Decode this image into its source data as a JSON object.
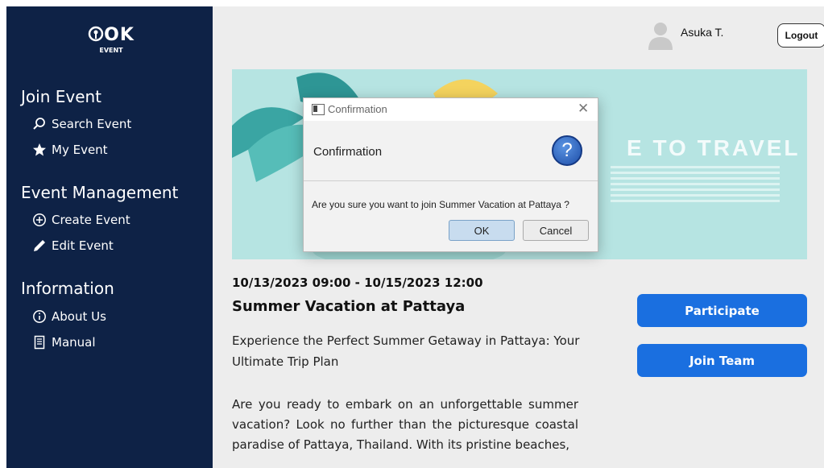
{
  "app": {
    "logo_mark": "OK",
    "logo_sub": "EVENT"
  },
  "sidebar": {
    "sections": [
      {
        "title": "Join Event",
        "items": [
          {
            "label": "Search Event",
            "icon": "search-icon"
          },
          {
            "label": "My Event",
            "icon": "star-icon"
          }
        ]
      },
      {
        "title": "Event Management",
        "items": [
          {
            "label": "Create Event",
            "icon": "plus-circle-icon"
          },
          {
            "label": "Edit Event",
            "icon": "pencil-icon"
          }
        ]
      },
      {
        "title": "Information",
        "items": [
          {
            "label": "About Us",
            "icon": "info-icon"
          },
          {
            "label": "Manual",
            "icon": "document-icon"
          }
        ]
      }
    ]
  },
  "header": {
    "username": "Asuka T.",
    "logout_label": "Logout"
  },
  "banner": {
    "text": "E TO TRAVEL"
  },
  "event": {
    "date": "10/13/2023 09:00 - 10/15/2023 12:00",
    "title": "Summer Vacation at Pattaya",
    "subtitle": "Experience the Perfect Summer Getaway in Pattaya: Your Ultimate Trip Plan",
    "description": "Are you ready to embark on an unforgettable summer vacation? Look no further than the picturesque coastal paradise of Pattaya, Thailand. With its pristine beaches,"
  },
  "actions": {
    "participate": "Participate",
    "join_team": "Join Team"
  },
  "dialog": {
    "window_title": "Confirmation",
    "header": "Confirmation",
    "question_glyph": "?",
    "content": "Are you sure you want to join Summer Vacation at Pattaya ?",
    "ok": "OK",
    "cancel": "Cancel"
  },
  "colors": {
    "sidebar_bg": "#0e2246",
    "primary": "#1a6fe0",
    "banner_bg": "#b6e4e2"
  }
}
